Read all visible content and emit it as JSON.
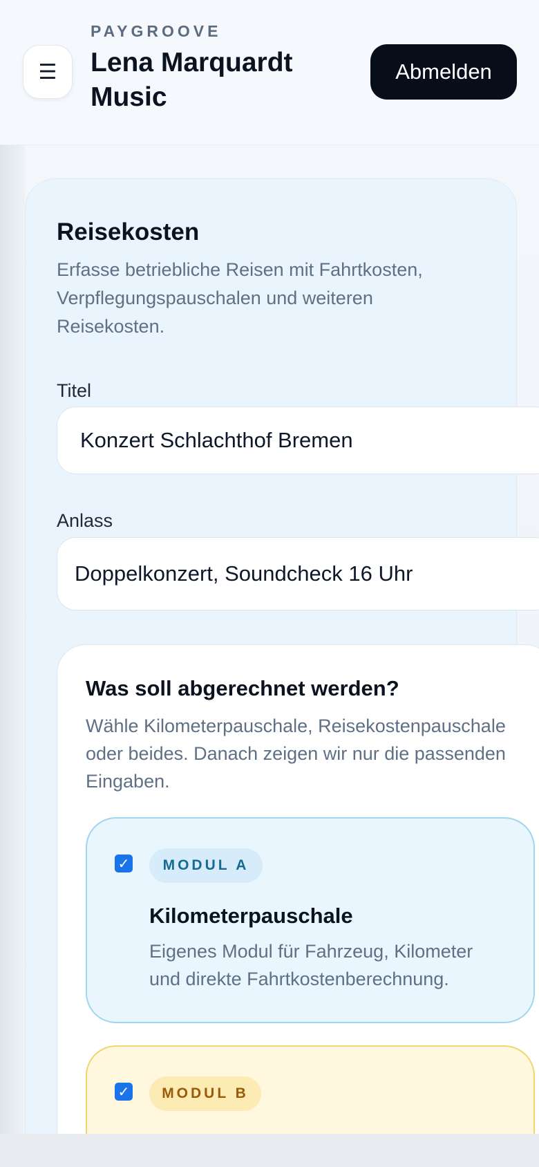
{
  "header": {
    "brand_kicker": "PAYGROOVE",
    "brand_name": "Lena Marquardt Music",
    "logout_label": "Abmelden",
    "menu_icon": "hamburger-icon"
  },
  "card": {
    "title": "Reisekosten",
    "description": "Erfasse betriebliche Reisen mit Fahrtkosten, Verpflegungspauschalen und weiteren Reisekosten."
  },
  "fields": {
    "title_label": "Titel",
    "title_value": "Konzert Schlachthof Bremen",
    "reason_label": "Anlass",
    "reason_value": "Doppelkonzert, Soundcheck 16 Uhr"
  },
  "section": {
    "title": "Was soll abgerechnet werden?",
    "description": "Wähle Kilometerpauschale, Reisekostenpauschale oder beides. Danach zeigen wir nur die passenden Eingaben."
  },
  "modules": [
    {
      "badge": "MODUL A",
      "title": "Kilometerpauschale",
      "description": "Eigenes Modul für Fahrzeug, Kilometer und direkte Fahrtkostenberechnung.",
      "checked": true,
      "accent": "#9fd5ef"
    },
    {
      "badge": "MODUL B",
      "checked": true,
      "accent": "#f3d46d"
    }
  ]
}
